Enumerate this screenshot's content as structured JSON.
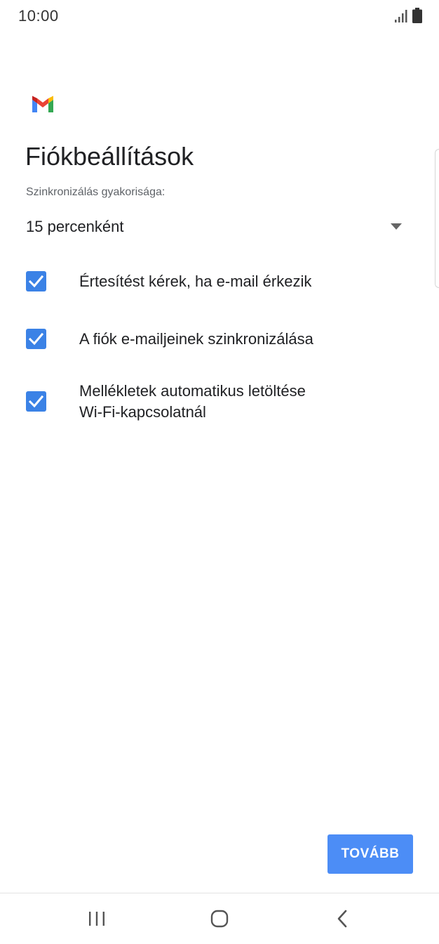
{
  "status_bar": {
    "time": "10:00",
    "icons": [
      "signal-icon",
      "battery-icon"
    ]
  },
  "app": {
    "logo": "gmail-logo-icon"
  },
  "page": {
    "title": "Fiókbeállítások"
  },
  "sync": {
    "label": "Szinkronizálás gyakorisága:",
    "selected_value": "15 percenként"
  },
  "options": [
    {
      "label": "Értesítést kérek, ha e-mail érkezik",
      "checked": true
    },
    {
      "label": "A fiók e-mailjeinek szinkronizálása",
      "checked": true
    },
    {
      "label_line1": "Mellékletek automatikus letöltése",
      "label_line2": "Wi-Fi-kapcsolatnál",
      "checked": true
    }
  ],
  "actions": {
    "continue_label": "TOVÁBB"
  },
  "colors": {
    "accent": "#4c8df6",
    "checkbox": "#3b82e6",
    "text_primary": "#202124",
    "text_secondary": "#5f6368"
  },
  "nav_bar": {
    "icons": [
      "recents-icon",
      "home-icon",
      "back-icon"
    ]
  }
}
